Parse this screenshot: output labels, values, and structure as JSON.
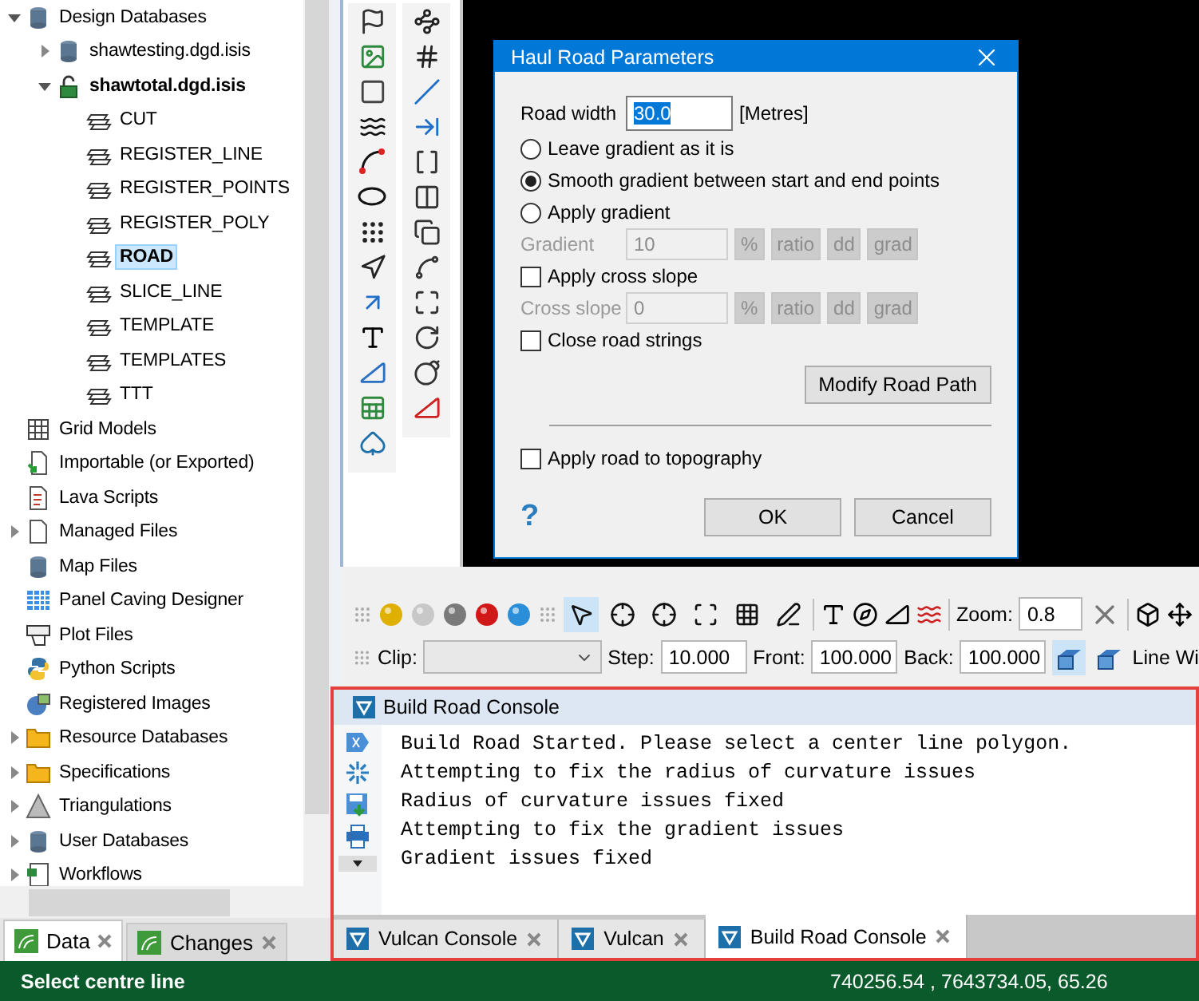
{
  "tree": [
    {
      "label": "Design Databases",
      "kind": "database",
      "expanded": true,
      "selected": false,
      "children": [
        {
          "label": "shawtesting.dgd.isis",
          "kind": "database",
          "expanded": false,
          "selected": false
        },
        {
          "label": "shawtotal.dgd.isis",
          "kind": "open-database",
          "expanded": true,
          "selected": false,
          "children": [
            {
              "label": "CUT",
              "kind": "layer",
              "selected": false
            },
            {
              "label": "REGISTER_LINE",
              "kind": "layer",
              "selected": false
            },
            {
              "label": "REGISTER_POINTS",
              "kind": "layer",
              "selected": false
            },
            {
              "label": "REGISTER_POLY",
              "kind": "layer",
              "selected": false
            },
            {
              "label": "ROAD",
              "kind": "layer",
              "selected": true
            },
            {
              "label": "SLICE_LINE",
              "kind": "layer",
              "selected": false
            },
            {
              "label": "TEMPLATE",
              "kind": "layer",
              "selected": false
            },
            {
              "label": "TEMPLATES",
              "kind": "layer",
              "selected": false
            },
            {
              "label": "TTT",
              "kind": "layer",
              "selected": false
            }
          ]
        }
      ]
    },
    {
      "label": "Grid Models",
      "kind": "grid",
      "selected": false
    },
    {
      "label": "Importable (or Exported)",
      "kind": "import",
      "selected": false
    },
    {
      "label": "Lava Scripts",
      "kind": "script",
      "selected": false
    },
    {
      "label": "Managed Files",
      "kind": "file",
      "expanded": false,
      "selected": false
    },
    {
      "label": "Map Files",
      "kind": "database",
      "selected": false
    },
    {
      "label": "Panel Caving Designer",
      "kind": "table",
      "selected": false
    },
    {
      "label": "Plot Files",
      "kind": "plot",
      "selected": false
    },
    {
      "label": "Python Scripts",
      "kind": "python",
      "selected": false
    },
    {
      "label": "Registered Images",
      "kind": "images",
      "selected": false
    },
    {
      "label": "Resource Databases",
      "kind": "folder",
      "expanded": false,
      "selected": false
    },
    {
      "label": "Specifications",
      "kind": "folder",
      "expanded": false,
      "selected": false
    },
    {
      "label": "Triangulations",
      "kind": "triangle",
      "expanded": false,
      "selected": false
    },
    {
      "label": "User Databases",
      "kind": "database",
      "expanded": false,
      "selected": false
    },
    {
      "label": "Workflows",
      "kind": "workflow",
      "expanded": false,
      "selected": false
    }
  ],
  "left_tabs": [
    {
      "label": "Data",
      "selected": true
    },
    {
      "label": "Changes",
      "selected": false
    }
  ],
  "dialog": {
    "title": "Haul Road Parameters",
    "road_width": {
      "label": "Road width",
      "value": "30.0",
      "unit": "[Metres]"
    },
    "gradient_options": [
      {
        "label": "Leave gradient as it is",
        "selected": false
      },
      {
        "label": "Smooth gradient between start and end points",
        "selected": true
      },
      {
        "label": "Apply gradient",
        "selected": false
      }
    ],
    "gradient": {
      "label": "Gradient",
      "value": "10",
      "disabled": true,
      "units": [
        "%",
        "ratio",
        "dd",
        "grad"
      ]
    },
    "cross_slope_check": {
      "label": "Apply cross slope",
      "checked": false
    },
    "cross_slope": {
      "label": "Cross slope",
      "value": "0",
      "disabled": true,
      "units": [
        "%",
        "ratio",
        "dd",
        "grad"
      ]
    },
    "close_strings": {
      "label": "Close road strings",
      "checked": false
    },
    "modify_button": "Modify Road Path",
    "topography": {
      "label": "Apply road to topography",
      "checked": false
    },
    "help": "?",
    "buttons": [
      "OK",
      "Cancel"
    ]
  },
  "toolbar": {
    "draw_tools": [
      {
        "selected": true
      },
      {
        "selected": false
      },
      {
        "selected": false
      },
      {
        "selected": false
      },
      {
        "selected": false
      },
      {
        "selected": false
      }
    ],
    "zoom": {
      "label": "Zoom:",
      "value": "0.8"
    },
    "clip": {
      "label": "Clip:"
    },
    "step": {
      "label": "Step:",
      "value": "10.000"
    },
    "front": {
      "label": "Front:",
      "value": "100.000"
    },
    "back": {
      "label": "Back:",
      "value": "100.000"
    },
    "clip_tools": [
      {
        "selected": true
      },
      {
        "selected": false
      }
    ],
    "cut_label": "Line Wi"
  },
  "console": {
    "title": "Build Road Console",
    "lines": [
      "Build Road Started. Please select a center line polygon.",
      "Attempting to fix the radius of curvature issues",
      "Radius of curvature issues fixed",
      "Attempting to fix the gradient issues",
      "Gradient issues fixed"
    ],
    "tabs": [
      {
        "label": "Vulcan Console",
        "selected": false
      },
      {
        "label": "Vulcan",
        "selected": false
      },
      {
        "label": "Build Road Console",
        "selected": true
      }
    ]
  },
  "status_bar": {
    "prompt": "Select centre line",
    "coordinates": "740256.54 , 7643734.05, 65.26"
  }
}
